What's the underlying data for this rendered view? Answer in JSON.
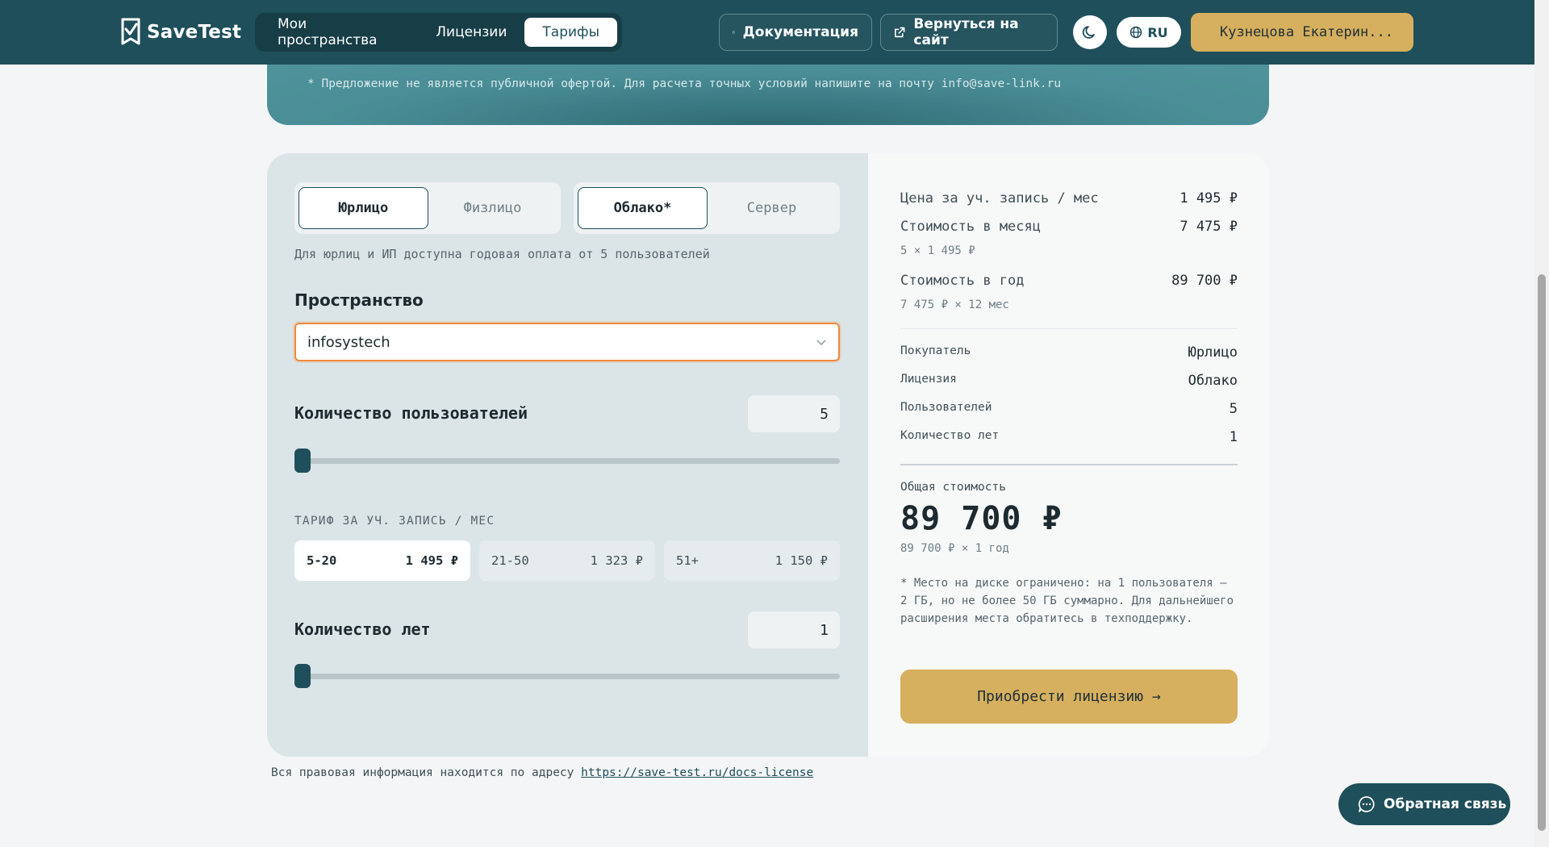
{
  "header": {
    "logo_text": "SaveTest",
    "nav": [
      {
        "label": "Мои пространства",
        "active": false
      },
      {
        "label": "Лицензии",
        "active": false
      },
      {
        "label": "Тарифы",
        "active": true
      }
    ],
    "docs_label": "Документация",
    "back_label": "Вернуться на сайт",
    "lang_label": "RU",
    "user_label": "Кузнецова Екатерин..."
  },
  "banner": {
    "note": "* Предложение не является публичной офертой. Для расчета точных условий напишите на почту info@save-link.ru"
  },
  "calculator": {
    "buyer_options": [
      {
        "label": "Юрлицо",
        "active": true
      },
      {
        "label": "Физлицо",
        "active": false
      }
    ],
    "license_options": [
      {
        "label": "Облако*",
        "active": true
      },
      {
        "label": "Сервер",
        "active": false
      }
    ],
    "hint": "Для юрлиц и ИП доступна годовая оплата от 5 пользователей",
    "space_label": "Пространство",
    "space_value": "infosystech",
    "users_label": "Количество пользователей",
    "users_value": "5",
    "tariff_label": "ТАРИФ ЗА УЧ. ЗАПИСЬ / МЕС",
    "tiers": [
      {
        "range": "5-20",
        "price": "1 495 ₽",
        "active": true
      },
      {
        "range": "21-50",
        "price": "1 323 ₽",
        "active": false
      },
      {
        "range": "51+",
        "price": "1 150 ₽",
        "active": false
      }
    ],
    "years_label": "Количество лет",
    "years_value": "1"
  },
  "summary": {
    "price_per_user_label": "Цена за уч. запись / мес",
    "price_per_user_value": "1 495 ₽",
    "monthly_label": "Стоимость в месяц",
    "monthly_value": "7 475 ₽",
    "monthly_sub": "5 × 1 495 ₽",
    "yearly_label": "Стоимость в год",
    "yearly_value": "89 700 ₽",
    "yearly_sub": "7 475 ₽ × 12 мес",
    "details": [
      {
        "k": "Покупатель",
        "v": "Юрлицо"
      },
      {
        "k": "Лицензия",
        "v": "Облако"
      },
      {
        "k": "Пользователей",
        "v": "5"
      },
      {
        "k": "Количество лет",
        "v": "1"
      }
    ],
    "total_label": "Общая стоимость",
    "total_value": "89 700 ₽",
    "total_sub": "89 700 ₽ × 1 год",
    "note": "* Место на диске ограничено: на 1 пользователя – 2 ГБ, но не более 50 ГБ суммарно. Для дальнейшего расширения места обратитесь в техподдержку.",
    "buy_label": "Приобрести лицензию →"
  },
  "footer": {
    "legal_text": "Вся правовая информация находится по адресу",
    "legal_link": "https://save-test.ru/docs-license"
  },
  "feedback_label": "Обратная связь",
  "colors": {
    "header": "#1f4f5a",
    "accent_gold": "#d6b05e",
    "focus_orange": "#f08a3c"
  }
}
